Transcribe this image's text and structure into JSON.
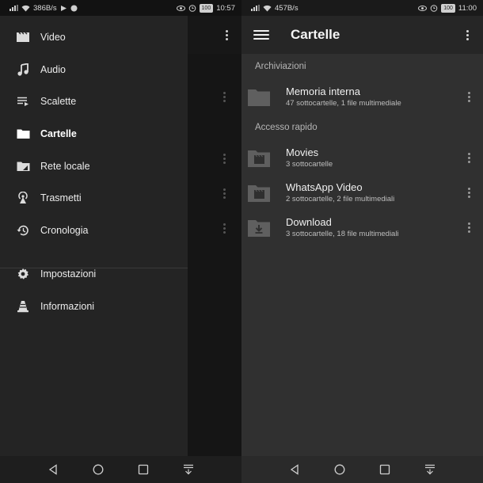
{
  "left": {
    "status": {
      "speed": "386B/s",
      "battery": "100",
      "time": "10:57"
    },
    "drawer": {
      "items": [
        {
          "label": "Video",
          "icon": "video-icon"
        },
        {
          "label": "Audio",
          "icon": "music-note-icon"
        },
        {
          "label": "Scalette",
          "icon": "playlist-icon"
        },
        {
          "label": "Cartelle",
          "icon": "folder-icon",
          "active": true
        },
        {
          "label": "Rete locale",
          "icon": "network-folder-icon"
        },
        {
          "label": "Trasmetti",
          "icon": "stream-icon"
        },
        {
          "label": "Cronologia",
          "icon": "history-icon"
        }
      ],
      "footer": [
        {
          "label": "Impostazioni",
          "icon": "gear-icon"
        },
        {
          "label": "Informazioni",
          "icon": "vlc-cone-icon"
        }
      ]
    }
  },
  "right": {
    "status": {
      "speed": "457B/s",
      "battery": "100",
      "time": "11:00"
    },
    "title": "Cartelle",
    "sections": [
      {
        "label": "Archiviazioni"
      },
      {
        "label": "Accesso rapido"
      }
    ],
    "folders": [
      {
        "name": "Memoria interna",
        "sub": "47 sottocartelle, 1 file multimediale",
        "icon": "folder-icon"
      },
      {
        "name": "Movies",
        "sub": "3 sottocartelle",
        "icon": "movie-folder-icon"
      },
      {
        "name": "WhatsApp Video",
        "sub": "2 sottocartelle, 2 file multimediali",
        "icon": "movie-folder-icon"
      },
      {
        "name": "Download",
        "sub": "3 sottocartelle, 18 file multimediali",
        "icon": "download-folder-icon"
      }
    ]
  },
  "colors": {
    "drawer_bg": "#242424",
    "app_bg": "#303030",
    "appbar_bg": "#262626",
    "icon_grey": "#666666"
  }
}
